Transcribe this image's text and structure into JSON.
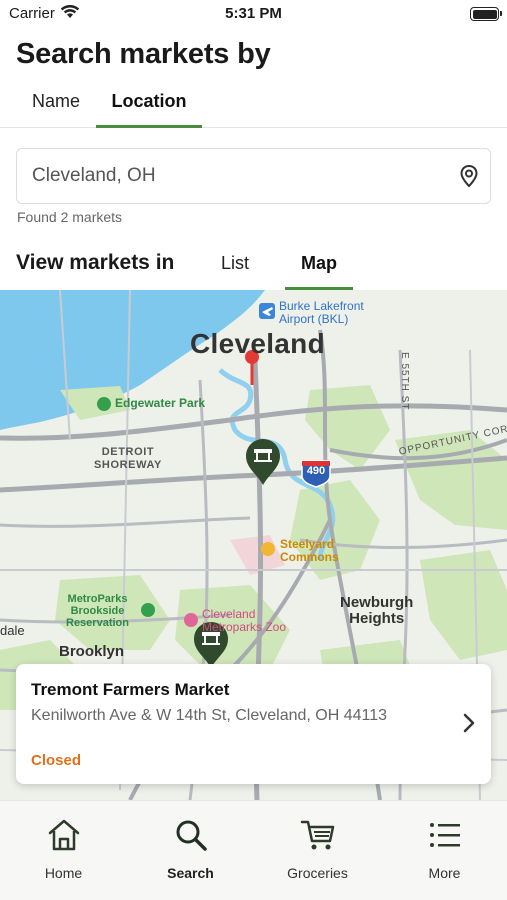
{
  "status_bar": {
    "carrier": "Carrier",
    "time": "5:31 PM"
  },
  "header": {
    "title": "Search markets by"
  },
  "search_tabs": [
    {
      "label": "Name",
      "active": false
    },
    {
      "label": "Location",
      "active": true
    }
  ],
  "search": {
    "value": "Cleveland, OH",
    "placeholder": "Cleveland, OH"
  },
  "results": {
    "found_text": "Found 2 markets"
  },
  "view_toggle": {
    "label": "View markets in",
    "options": [
      {
        "label": "List",
        "active": false
      },
      {
        "label": "Map",
        "active": true
      }
    ]
  },
  "map": {
    "city_label": "Cleveland",
    "airport_label": [
      "Burke Lakefront",
      "Airport (BKL)"
    ],
    "labels": {
      "edgewater": "Edgewater Park",
      "detroit": [
        "DETROIT",
        "SHOREWAY"
      ],
      "highway": "490",
      "opportunity": "OPPORTUNITY CORRI",
      "e55": "E 55TH ST",
      "steelyard": [
        "Steelyard",
        "Commons"
      ],
      "metroparks": [
        "MetroParks",
        "Brookside",
        "Reservation"
      ],
      "zoo": [
        "Cleveland",
        "Metroparks Zoo"
      ],
      "newburgh": [
        "Newburgh",
        "Heights"
      ],
      "brooklyn": "Brooklyn",
      "dale": "dale"
    },
    "marker_colors": {
      "market": "#2f4a2c",
      "search_pin": "#e53935"
    }
  },
  "market_card": {
    "name": "Tremont Farmers Market",
    "address": "Kenilworth Ave & W 14th St, Cleveland, OH 44113",
    "status": "Closed",
    "status_color": "#e0701e"
  },
  "tab_bar": [
    {
      "label": "Home",
      "icon": "home-icon",
      "active": false
    },
    {
      "label": "Search",
      "icon": "search-icon",
      "active": true
    },
    {
      "label": "Groceries",
      "icon": "cart-icon",
      "active": false
    },
    {
      "label": "More",
      "icon": "list-icon",
      "active": false
    }
  ],
  "colors": {
    "accent": "#4a8c3e",
    "water": "#7ec8ee",
    "park": "#cfe6b9"
  }
}
